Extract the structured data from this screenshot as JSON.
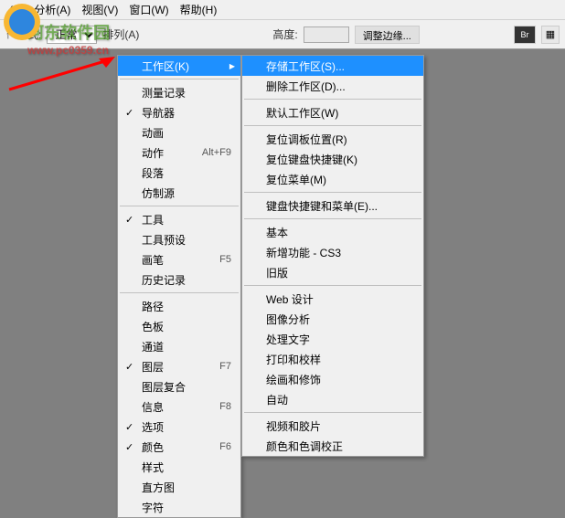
{
  "menubar": {
    "items": [
      "(T)",
      "分析(A)",
      "视图(V)",
      "窗口(W)",
      "帮助(H)"
    ]
  },
  "toolbar": {
    "style_label": "样式:",
    "style_value": "正常",
    "sort_label": "排列(A)",
    "height_label": "高度:",
    "adjust_label": "调整边缘...",
    "br_icon": "Br"
  },
  "watermark": {
    "text": "河东软件园",
    "url": "www.pc0359.cn"
  },
  "menu1": {
    "items": [
      {
        "label": "工作区(K)",
        "highlighted": true,
        "has_sub": true
      },
      {
        "sep": true
      },
      {
        "label": "测量记录"
      },
      {
        "label": "导航器",
        "checked": true
      },
      {
        "label": "动画"
      },
      {
        "label": "动作",
        "shortcut": "Alt+F9"
      },
      {
        "label": "段落"
      },
      {
        "label": "仿制源"
      },
      {
        "sep": true
      },
      {
        "label": "工具",
        "checked": true
      },
      {
        "label": "工具预设"
      },
      {
        "label": "画笔",
        "shortcut": "F5"
      },
      {
        "label": "历史记录"
      },
      {
        "sep": true
      },
      {
        "label": "路径"
      },
      {
        "label": "色板"
      },
      {
        "label": "通道"
      },
      {
        "label": "图层",
        "checked": true,
        "shortcut": "F7"
      },
      {
        "label": "图层复合"
      },
      {
        "label": "信息",
        "shortcut": "F8"
      },
      {
        "label": "选项",
        "checked": true
      },
      {
        "label": "颜色",
        "checked": true,
        "shortcut": "F6"
      },
      {
        "label": "样式"
      },
      {
        "label": "直方图"
      },
      {
        "label": "字符"
      }
    ]
  },
  "menu2": {
    "items": [
      {
        "label": "存储工作区(S)...",
        "highlighted": true
      },
      {
        "label": "删除工作区(D)..."
      },
      {
        "sep": true
      },
      {
        "label": "默认工作区(W)"
      },
      {
        "sep": true
      },
      {
        "label": "复位调板位置(R)"
      },
      {
        "label": "复位键盘快捷键(K)"
      },
      {
        "label": "复位菜单(M)"
      },
      {
        "sep": true
      },
      {
        "label": "键盘快捷键和菜单(E)..."
      },
      {
        "sep": true
      },
      {
        "label": "基本"
      },
      {
        "label": "新增功能 - CS3"
      },
      {
        "label": "旧版"
      },
      {
        "sep": true
      },
      {
        "label": "Web 设计"
      },
      {
        "label": "图像分析"
      },
      {
        "label": "处理文字"
      },
      {
        "label": "打印和校样"
      },
      {
        "label": "绘画和修饰"
      },
      {
        "label": "自动"
      },
      {
        "sep": true
      },
      {
        "label": "视频和胶片"
      },
      {
        "label": "颜色和色调校正"
      }
    ]
  }
}
